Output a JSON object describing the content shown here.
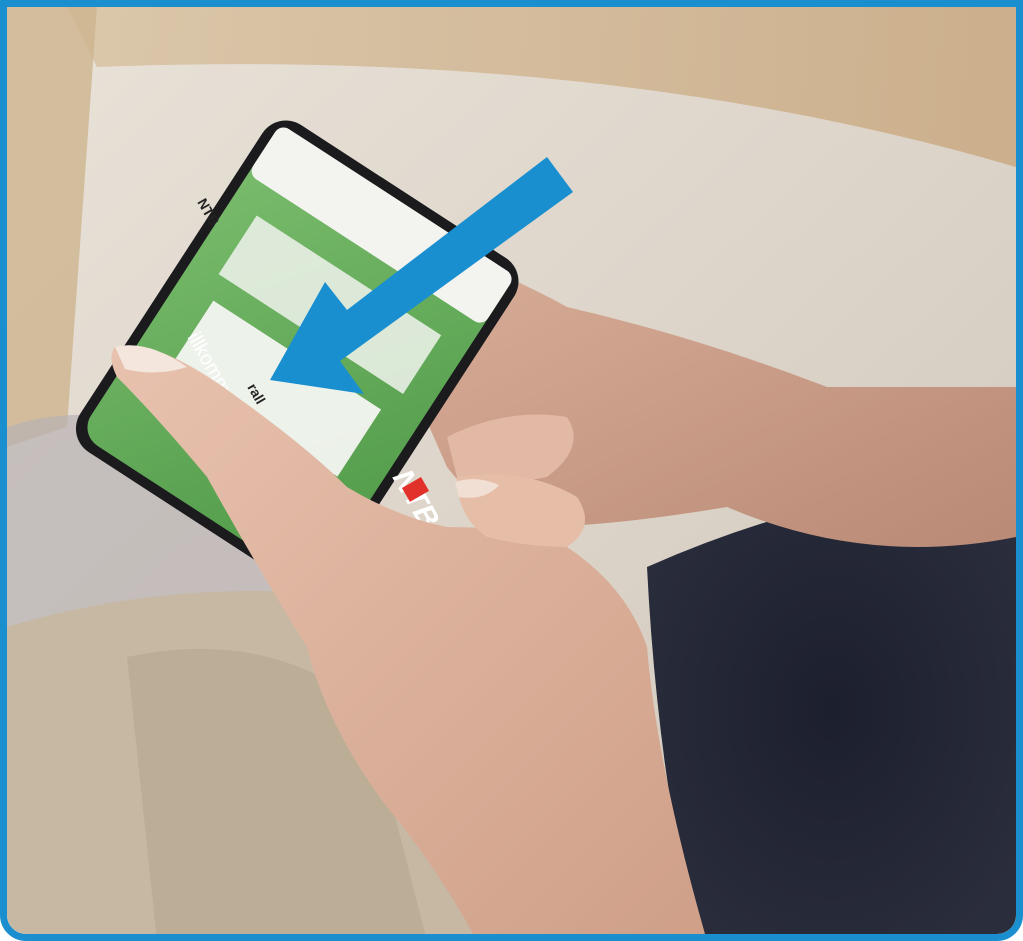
{
  "photo": {
    "subject": "hands holding smartphone",
    "frame_color": "#1a8fd0",
    "arrow_color": "#1a8fd0",
    "screen_color": "#5faa55"
  },
  "phone_screen": {
    "brand_top": "NTB",
    "welcome_text": "illkommen",
    "heading_fragment": "rall",
    "brand_bottom": "NTB"
  }
}
